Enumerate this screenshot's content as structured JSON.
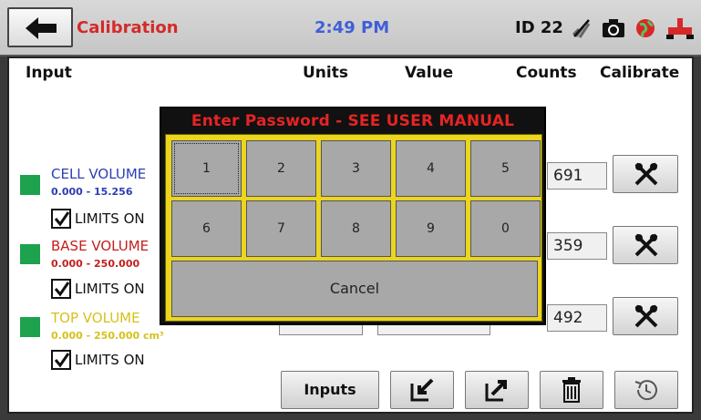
{
  "header": {
    "title": "Calibration",
    "time": "2:49 PM",
    "device_id": "ID 22",
    "icons": [
      "back-arrow-icon",
      "wifi-off-icon",
      "camera-icon",
      "globe-icon",
      "valve-icon"
    ]
  },
  "columns": {
    "input": "Input",
    "units": "Units",
    "value": "Value",
    "counts": "Counts",
    "calibrate": "Calibrate"
  },
  "sensors": [
    {
      "name": "CELL VOLUME",
      "range": "0.000 - 15.256",
      "limits": "LIMITS ON",
      "counts": "691",
      "name_color": "#2b3fb0",
      "range_color": "#2b3fb0",
      "status_color": "#1ea24e"
    },
    {
      "name": "BASE VOLUME",
      "range": "0.000 - 250.000",
      "limits": "LIMITS ON",
      "counts": "359",
      "name_color": "#c41e1e",
      "range_color": "#c41e1e",
      "status_color": "#1ea24e"
    },
    {
      "name": "TOP VOLUME",
      "range": "0.000 - 250.000 cm³",
      "limits": "LIMITS ON",
      "counts": "492",
      "name_color": "#d6c21c",
      "range_color": "#d6c21c",
      "status_color": "#1ea24e"
    }
  ],
  "footer": {
    "inputs_label": "Inputs",
    "icons": [
      "import-icon",
      "export-icon",
      "trash-icon",
      "history-icon"
    ]
  },
  "dialog": {
    "title": "Enter Password - SEE USER MANUAL",
    "keys": [
      "1",
      "2",
      "3",
      "4",
      "5",
      "6",
      "7",
      "8",
      "9",
      "0"
    ],
    "cancel": "Cancel",
    "frame_color": "#111111",
    "keypad_color": "#ebd51e"
  }
}
